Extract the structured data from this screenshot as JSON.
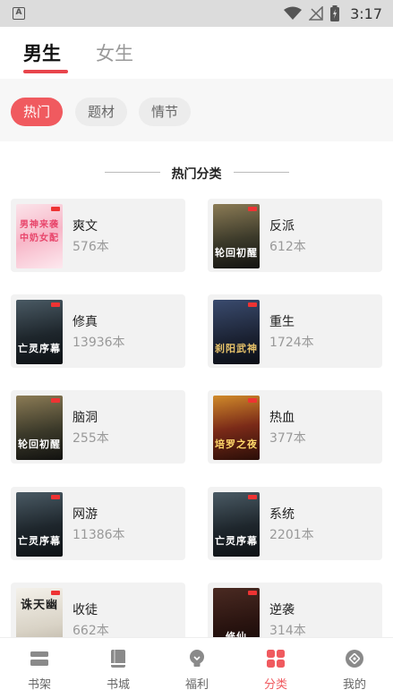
{
  "status_bar": {
    "time": "3:17",
    "app_badge": "A"
  },
  "gender_tabs": [
    {
      "label": "男生",
      "active": true
    },
    {
      "label": "女生",
      "active": false
    }
  ],
  "filters": [
    {
      "label": "热门",
      "active": true
    },
    {
      "label": "题材",
      "active": false
    },
    {
      "label": "情节",
      "active": false
    }
  ],
  "section": {
    "title": "热门分类"
  },
  "categories": [
    {
      "name": "爽文",
      "count": "576本",
      "cover_style": "pink",
      "cover_text": "男神来袭中奶女配"
    },
    {
      "name": "反派",
      "count": "612本",
      "cover_style": "war",
      "cover_text": "轮回初醒"
    },
    {
      "name": "修真",
      "count": "13936本",
      "cover_style": "dark",
      "cover_text": "亡灵序幕"
    },
    {
      "name": "重生",
      "count": "1724本",
      "cover_style": "blue",
      "cover_text": "刹阳武神"
    },
    {
      "name": "脑洞",
      "count": "255本",
      "cover_style": "war",
      "cover_text": "轮回初醒"
    },
    {
      "name": "热血",
      "count": "377本",
      "cover_style": "fire",
      "cover_text": "培罗之夜"
    },
    {
      "name": "网游",
      "count": "11386本",
      "cover_style": "dark",
      "cover_text": "亡灵序幕"
    },
    {
      "name": "系统",
      "count": "2201本",
      "cover_style": "dark",
      "cover_text": "亡灵序幕"
    },
    {
      "name": "收徒",
      "count": "662本",
      "cover_style": "ink",
      "cover_text": "诛天幽"
    },
    {
      "name": "逆袭",
      "count": "314本",
      "cover_style": "red",
      "cover_text": "修仙"
    }
  ],
  "bottom_nav": [
    {
      "label": "书架",
      "icon": "bookshelf-icon",
      "active": false
    },
    {
      "label": "书城",
      "icon": "book-icon",
      "active": false
    },
    {
      "label": "福利",
      "icon": "lightbulb-icon",
      "active": false
    },
    {
      "label": "分类",
      "icon": "category-grid-icon",
      "active": true
    },
    {
      "label": "我的",
      "icon": "profile-icon",
      "active": false
    }
  ],
  "colors": {
    "accent": "#f05a5f",
    "tab_underline": "#e8454c",
    "inactive_nav": "#8a8a8a"
  }
}
